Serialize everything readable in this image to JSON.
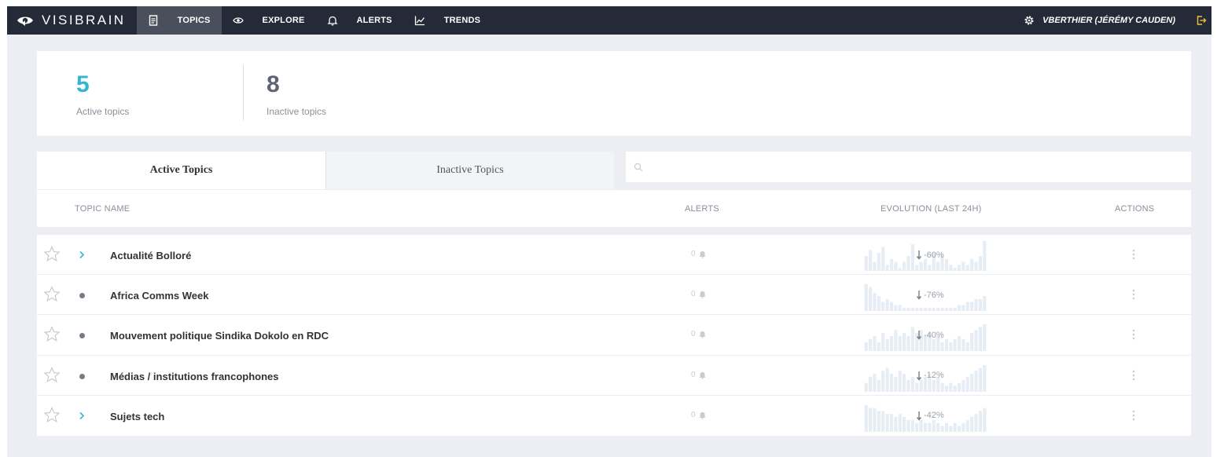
{
  "brand": {
    "name": "VISIBRAIN"
  },
  "nav": [
    {
      "label": "TOPICS",
      "icon": "document-icon",
      "active": true
    },
    {
      "label": "EXPLORE",
      "icon": "eye-icon",
      "active": false
    },
    {
      "label": "ALERTS",
      "icon": "bell-icon",
      "active": false
    },
    {
      "label": "TRENDS",
      "icon": "chart-icon",
      "active": false
    }
  ],
  "user": {
    "name": "VBERTHIER (JÉRÉMY CAUDEN)",
    "settings_icon": "gear-icon",
    "logout_icon": "logout-icon"
  },
  "stats": {
    "active_count": "5",
    "active_label": "Active topics",
    "inactive_count": "8",
    "inactive_label": "Inactive topics"
  },
  "tabs": {
    "active": "Active Topics",
    "inactive": "Inactive Topics"
  },
  "search": {
    "placeholder": "",
    "value": ""
  },
  "table": {
    "headers": {
      "name": "TOPIC NAME",
      "alerts": "ALERTS",
      "evolution": "EVOLUTION (LAST 24H)",
      "actions": "ACTIONS"
    },
    "rows": [
      {
        "name": "Actualité Bolloré",
        "marker": "chevron",
        "alerts": "0",
        "evolution": "-60%",
        "spark": [
          0.5,
          0.7,
          0.3,
          0.6,
          0.8,
          0.2,
          0.4,
          0.3,
          0.1,
          0.3,
          0.5,
          0.9,
          0.2,
          0.3,
          0.4,
          0.2,
          0.6,
          0.3,
          0.5,
          0.4,
          0.2,
          0.1,
          0.2,
          0.3,
          0.2,
          0.4,
          0.3,
          0.5,
          1.0
        ]
      },
      {
        "name": "Africa Comms Week",
        "marker": "dot",
        "alerts": "0",
        "evolution": "-76%",
        "spark": [
          0.9,
          0.8,
          0.6,
          0.5,
          0.3,
          0.4,
          0.3,
          0.2,
          0.2,
          0.1,
          0.1,
          0.1,
          0.1,
          0.1,
          0.1,
          0.1,
          0.1,
          0.1,
          0.1,
          0.1,
          0.1,
          0.1,
          0.2,
          0.2,
          0.3,
          0.3,
          0.4,
          0.4,
          0.5
        ]
      },
      {
        "name": "Mouvement politique Sindika Dokolo en RDC",
        "marker": "dot",
        "alerts": "0",
        "evolution": "-40%",
        "spark": [
          0.3,
          0.4,
          0.5,
          0.3,
          0.6,
          0.4,
          0.5,
          0.7,
          0.5,
          0.6,
          0.5,
          0.8,
          0.6,
          0.7,
          0.5,
          0.6,
          0.4,
          0.5,
          0.3,
          0.4,
          0.3,
          0.4,
          0.5,
          0.4,
          0.3,
          0.6,
          0.7,
          0.8,
          0.9
        ]
      },
      {
        "name": "Médias / institutions francophones",
        "marker": "dot",
        "alerts": "0",
        "evolution": "-12%",
        "spark": [
          0.3,
          0.5,
          0.6,
          0.4,
          0.7,
          0.8,
          0.6,
          0.5,
          0.7,
          0.6,
          0.4,
          0.5,
          0.3,
          0.4,
          0.5,
          0.6,
          0.4,
          0.5,
          0.3,
          0.2,
          0.3,
          0.2,
          0.3,
          0.4,
          0.5,
          0.6,
          0.7,
          0.8,
          0.9
        ]
      },
      {
        "name": "Sujets tech",
        "marker": "chevron",
        "alerts": "0",
        "evolution": "-42%",
        "spark": [
          0.9,
          0.8,
          0.8,
          0.7,
          0.7,
          0.6,
          0.6,
          0.5,
          0.6,
          0.5,
          0.4,
          0.4,
          0.3,
          0.4,
          0.3,
          0.3,
          0.4,
          0.3,
          0.2,
          0.3,
          0.2,
          0.3,
          0.2,
          0.3,
          0.4,
          0.5,
          0.6,
          0.7,
          0.8
        ]
      }
    ]
  },
  "colors": {
    "nav_bg": "#252a38",
    "accent": "#35b6d0",
    "page_bg": "#eceef3"
  }
}
